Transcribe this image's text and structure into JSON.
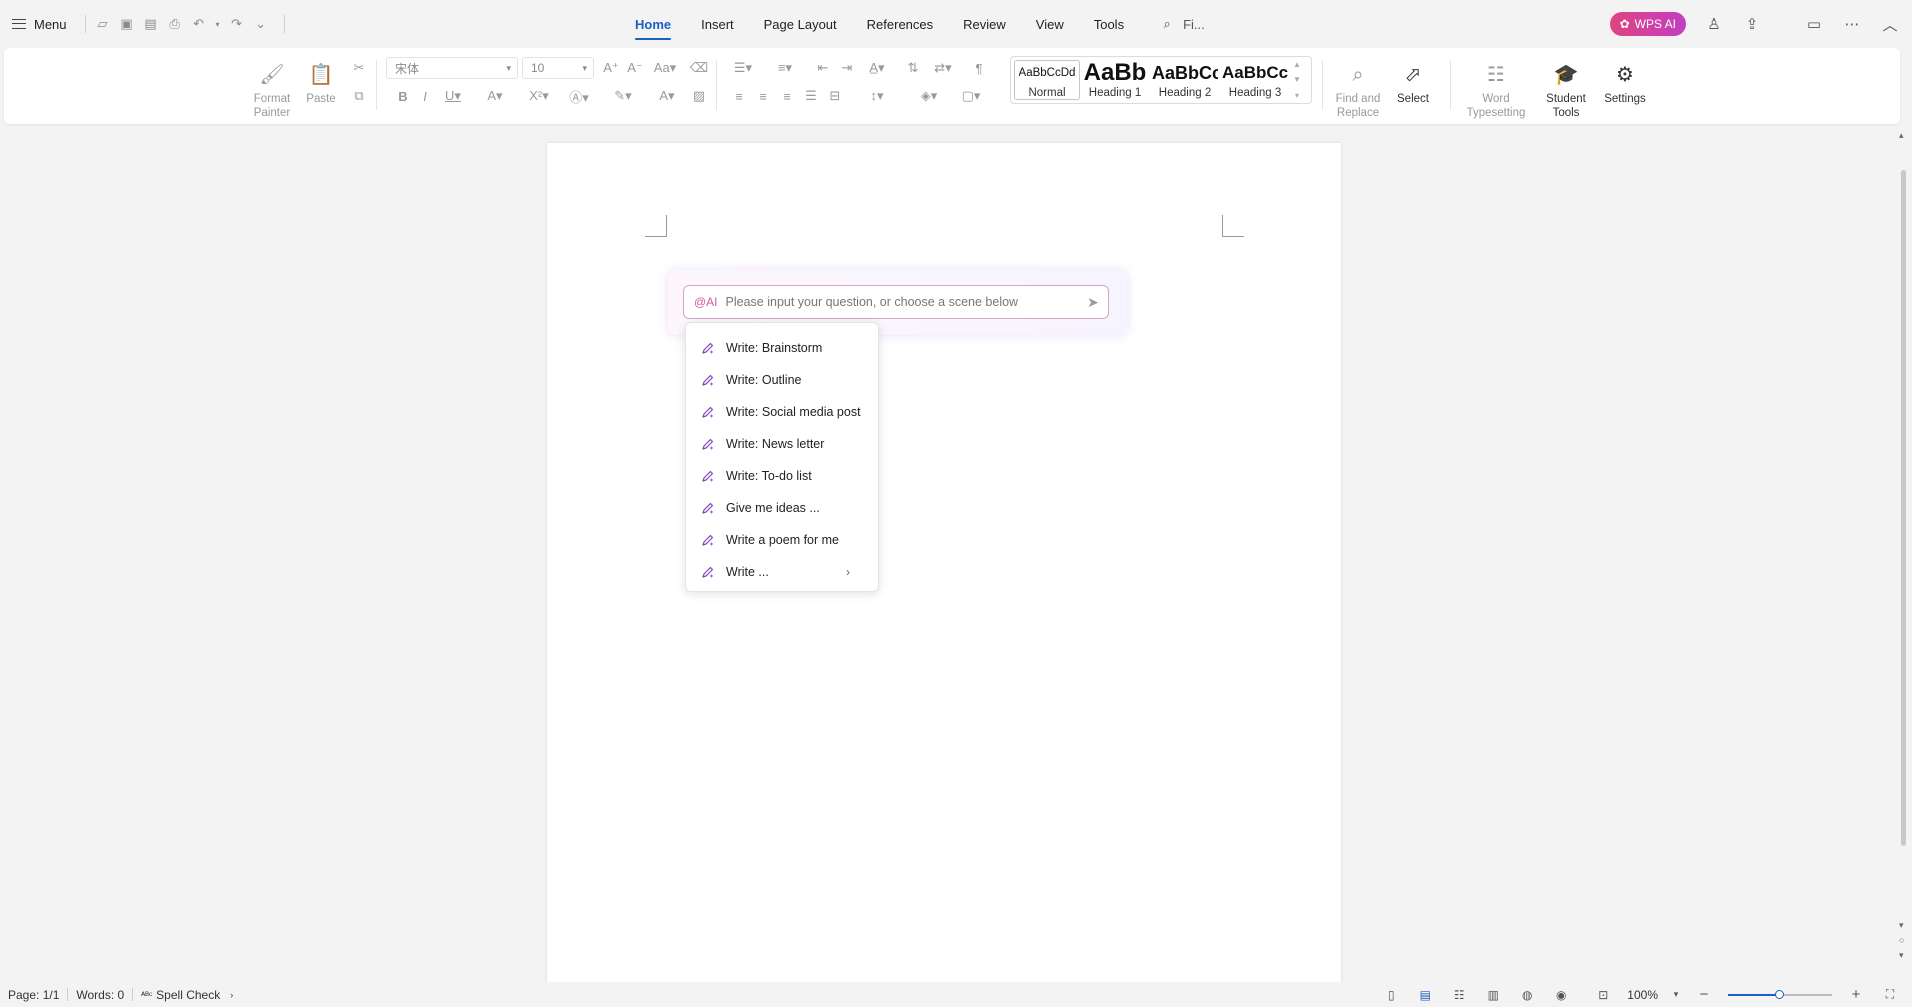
{
  "topbar": {
    "menu_label": "Menu",
    "tabs": [
      "Home",
      "Insert",
      "Page Layout",
      "References",
      "Review",
      "View",
      "Tools"
    ],
    "active_tab": "Home",
    "search_label": "Fi...",
    "wps_ai_label": "WPS AI"
  },
  "ribbon": {
    "format_painter": "Format Painter",
    "paste": "Paste",
    "font_name": "宋体",
    "font_size": "10",
    "styles": [
      {
        "sample": "AaBbCcDd",
        "name": "Normal"
      },
      {
        "sample": "AaBb",
        "name": "Heading 1"
      },
      {
        "sample": "AaBbCc",
        "name": "Heading 2"
      },
      {
        "sample": "AaBbCc",
        "name": "Heading 3"
      }
    ],
    "find_replace": "Find and Replace",
    "select": "Select",
    "word_typesetting": "Word Typesetting",
    "student_tools": "Student Tools",
    "settings": "Settings"
  },
  "ai": {
    "tag": "@AI",
    "placeholder": "Please input your question, or choose a scene below",
    "scenes": [
      "Write: Brainstorm",
      "Write: Outline",
      "Write: Social media post",
      "Write: News letter",
      "Write: To-do list",
      "Give me ideas ...",
      "Write a poem for me",
      "Write ..."
    ]
  },
  "status": {
    "page": "Page: 1/1",
    "words": "Words: 0",
    "spell_check": "Spell Check",
    "zoom": "100%",
    "zoom_fraction": 0.5
  },
  "colors": {
    "accent": "#1b5fc4",
    "ai_pink": "#d05a9c"
  }
}
